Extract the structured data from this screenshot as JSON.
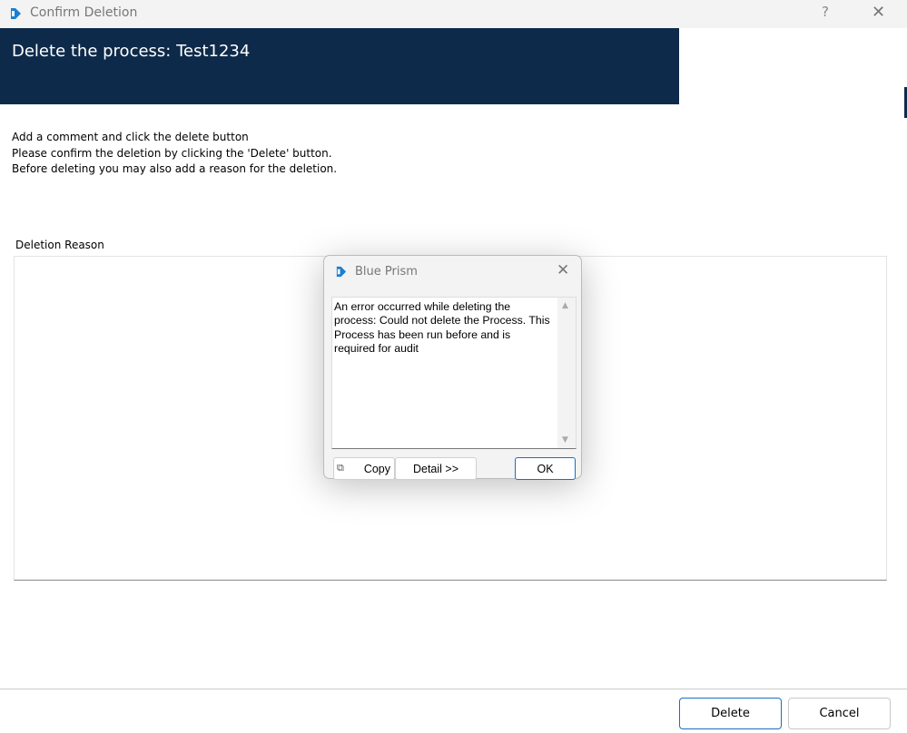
{
  "window": {
    "title": "Confirm Deletion",
    "help": "?",
    "close": "✕"
  },
  "banner": {
    "title": "Delete the process: Test1234"
  },
  "instructions": [
    "Add a comment and click the delete button",
    "Please confirm the deletion by clicking the 'Delete' button.",
    "Before deleting you may also add a reason for the deletion."
  ],
  "reason": {
    "label": "Deletion Reason",
    "value": ""
  },
  "buttons": {
    "delete": "Delete",
    "cancel": "Cancel"
  },
  "dialog": {
    "title": "Blue Prism",
    "close": "✕",
    "message": "An error occurred while deleting the process: Could not delete the Process. This Process has been run before and is required for audit",
    "copy": "Copy",
    "detail": "Detail >>",
    "ok": "OK"
  },
  "colors": {
    "banner": "#0e2a4a",
    "accent": "#1a6fc4"
  }
}
